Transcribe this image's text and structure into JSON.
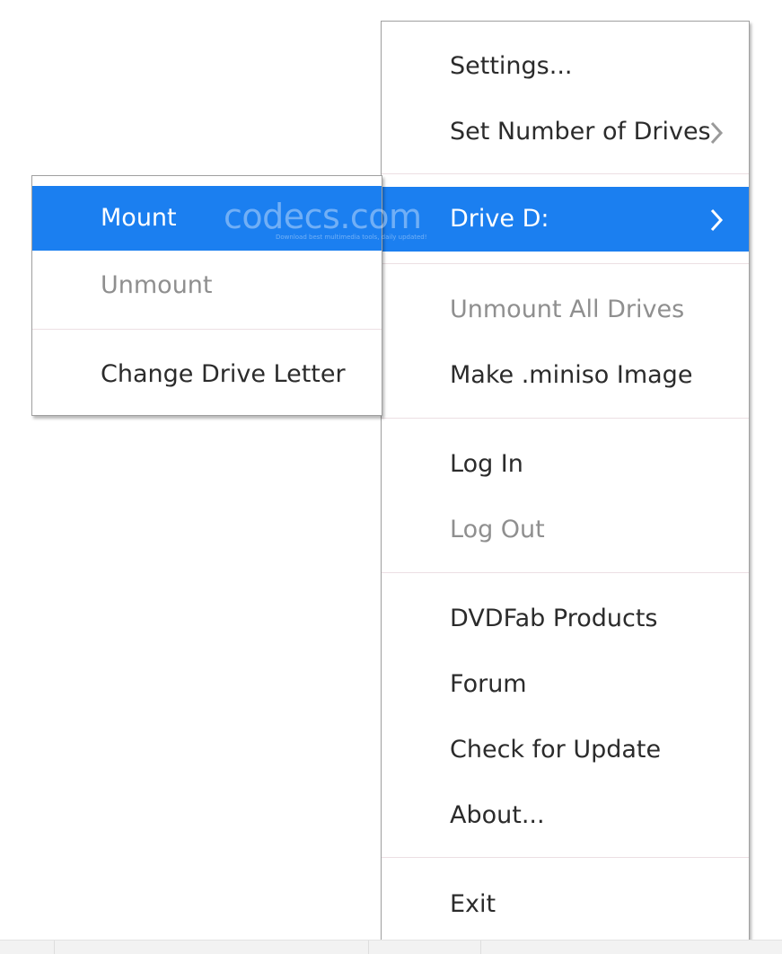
{
  "main_menu": {
    "items": [
      {
        "label": "Settings...",
        "enabled": true
      },
      {
        "label": "Set Number of Drives",
        "enabled": true,
        "submenu": true
      },
      {
        "label": "Drive D:",
        "enabled": true,
        "submenu": true,
        "highlighted": true
      },
      {
        "label": "Unmount All Drives",
        "enabled": false
      },
      {
        "label": "Make .miniso Image",
        "enabled": true
      },
      {
        "label": "Log In",
        "enabled": true
      },
      {
        "label": "Log Out",
        "enabled": false
      },
      {
        "label": "DVDFab Products",
        "enabled": true
      },
      {
        "label": "Forum",
        "enabled": true
      },
      {
        "label": "Check for Update",
        "enabled": true
      },
      {
        "label": "About...",
        "enabled": true
      },
      {
        "label": "Exit",
        "enabled": true
      }
    ]
  },
  "drive_submenu": {
    "items": [
      {
        "label": "Mount",
        "enabled": true,
        "highlighted": true
      },
      {
        "label": "Unmount",
        "enabled": false
      },
      {
        "label": "Change Drive Letter",
        "enabled": true
      }
    ]
  },
  "watermark": {
    "brand": "codecs.com",
    "tagline": "Download best multimedia tools, daily updated!"
  },
  "colors": {
    "highlight": "#1b7ff0",
    "text": "#2b2b2b",
    "disabled_text": "#8f8f8f",
    "separator": "#ecdfe3",
    "border": "#a0a0a0"
  },
  "icons": {
    "submenu_arrow": "chevron-right-icon"
  }
}
